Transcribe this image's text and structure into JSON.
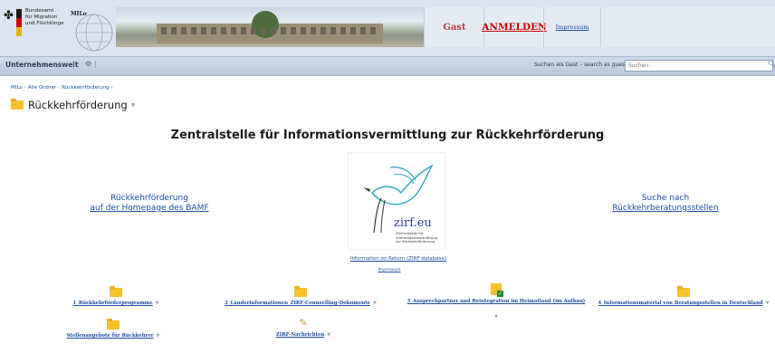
{
  "header": {
    "org_lines": "Bundesamt\nfür Migration\nund Flüchtlinge",
    "milo_logo_text": "MILo",
    "tabs": {
      "gast": "Gast",
      "anmelden": "ANMELDEN",
      "impressum": "Impressum"
    }
  },
  "topnav": {
    "left_label": "Unternehmensweit",
    "search_label": "Suchen als Gast – search as guest",
    "search_placeholder": "Suchen"
  },
  "breadcrumb": [
    "MILo",
    "Alle Ordner",
    "Rückkehrförderung"
  ],
  "page_title": "Rückkehrförderung",
  "main": {
    "heading": "Zentralstelle für Informationsvermittlung zur Rückkehrförderung",
    "left_link": {
      "line1": "Rückkehrförderung",
      "line2": "auf der Homepage des BAMF"
    },
    "right_link": {
      "line1": "Suche nach",
      "line2": "Rückkehrberatungsstellen"
    },
    "logo": {
      "brand": "zirf.eu",
      "subtitle": "Zentralstelle für\nInformationsvermittlung\nzur Rückkehrförderung"
    },
    "info_link": "Information on Return (ZIRF database)",
    "impressum_link": "Impressum"
  },
  "folders": [
    {
      "label": "1_Rückkehrförderprogramme",
      "icon": "folder-icon"
    },
    {
      "label": "2_Länderinformationen_ZIRF-Counselling-Dokumente",
      "icon": "folder-icon"
    },
    {
      "label": "3_Ansprechpartner und Reintegration im Heimatland (im Aufbau)",
      "icon": "document-check-icon"
    },
    {
      "label": "4_Informationsmaterial von Beratungsstellen in Deutschland",
      "icon": "folder-icon"
    },
    {
      "label": "Stellenangebote für Rückkehrer",
      "icon": "folder-icon"
    },
    {
      "label": "ZIRF-Nachrichten",
      "icon": "pencil-icon"
    }
  ],
  "colors": {
    "link": "#1a4fa0",
    "accent_red": "#d10000",
    "header_bg": "#dbe4f0",
    "folder": "#f6c22b"
  }
}
